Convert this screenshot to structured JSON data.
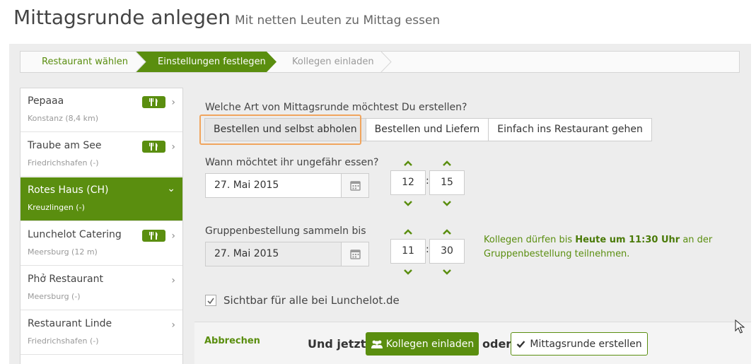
{
  "header": {
    "title": "Mittagsrunde anlegen",
    "subtitle": "Mit netten Leuten zu Mittag essen"
  },
  "wizard": {
    "steps": [
      {
        "label": "Restaurant wählen",
        "state": "done"
      },
      {
        "label": "Einstellungen festlegen",
        "state": "active"
      },
      {
        "label": "Kollegen einladen",
        "state": "upcoming"
      }
    ]
  },
  "restaurants": [
    {
      "name": "Pepaaa",
      "location": "Konstanz (8,4 km)",
      "badge": true,
      "active": false
    },
    {
      "name": "Traube am See",
      "location": "Friedrichshafen (-)",
      "badge": true,
      "active": false
    },
    {
      "name": "Rotes Haus (CH)",
      "location": "Kreuzlingen (-)",
      "badge": false,
      "active": true
    },
    {
      "name": "Lunchelot Catering",
      "location": "Meersburg (12 m)",
      "badge": true,
      "active": false
    },
    {
      "name": "Phở Restaurant",
      "location": "Meersburg (-)",
      "badge": false,
      "active": false
    },
    {
      "name": "Restaurant Linde",
      "location": "Friedrichshafen (-)",
      "badge": false,
      "active": false
    }
  ],
  "form": {
    "type_question": "Welche Art von Mittagsrunde möchtest Du erstellen?",
    "type_options": [
      "Bestellen und selbst abholen",
      "Bestellen und Liefern",
      "Einfach ins Restaurant gehen"
    ],
    "when_label": "Wann möchtet ihr ungefähr essen?",
    "when_date": "27. Mai 2015",
    "when_hour": "12",
    "when_minute": "15",
    "collect_label": "Gruppenbestellung sammeln bis",
    "collect_date": "27. Mai 2015",
    "collect_hour": "11",
    "collect_minute": "30",
    "info_pre": "Kollegen dürfen bis ",
    "info_bold": "Heute um 11:30 Uhr",
    "info_post": " an der Gruppenbestellung teilnehmen.",
    "visible_label": "Sichtbar für alle bei Lunchelot.de",
    "visible_checked": true
  },
  "footer": {
    "cancel": "Abbrechen",
    "und_jetzt": "Und jetzt:",
    "invite_button": "Kollegen einladen",
    "oder": "oder",
    "create_button": "Mittagsrunde erstellen"
  },
  "colors": {
    "accent": "#5a8e0f",
    "highlight": "#f0a55e"
  }
}
